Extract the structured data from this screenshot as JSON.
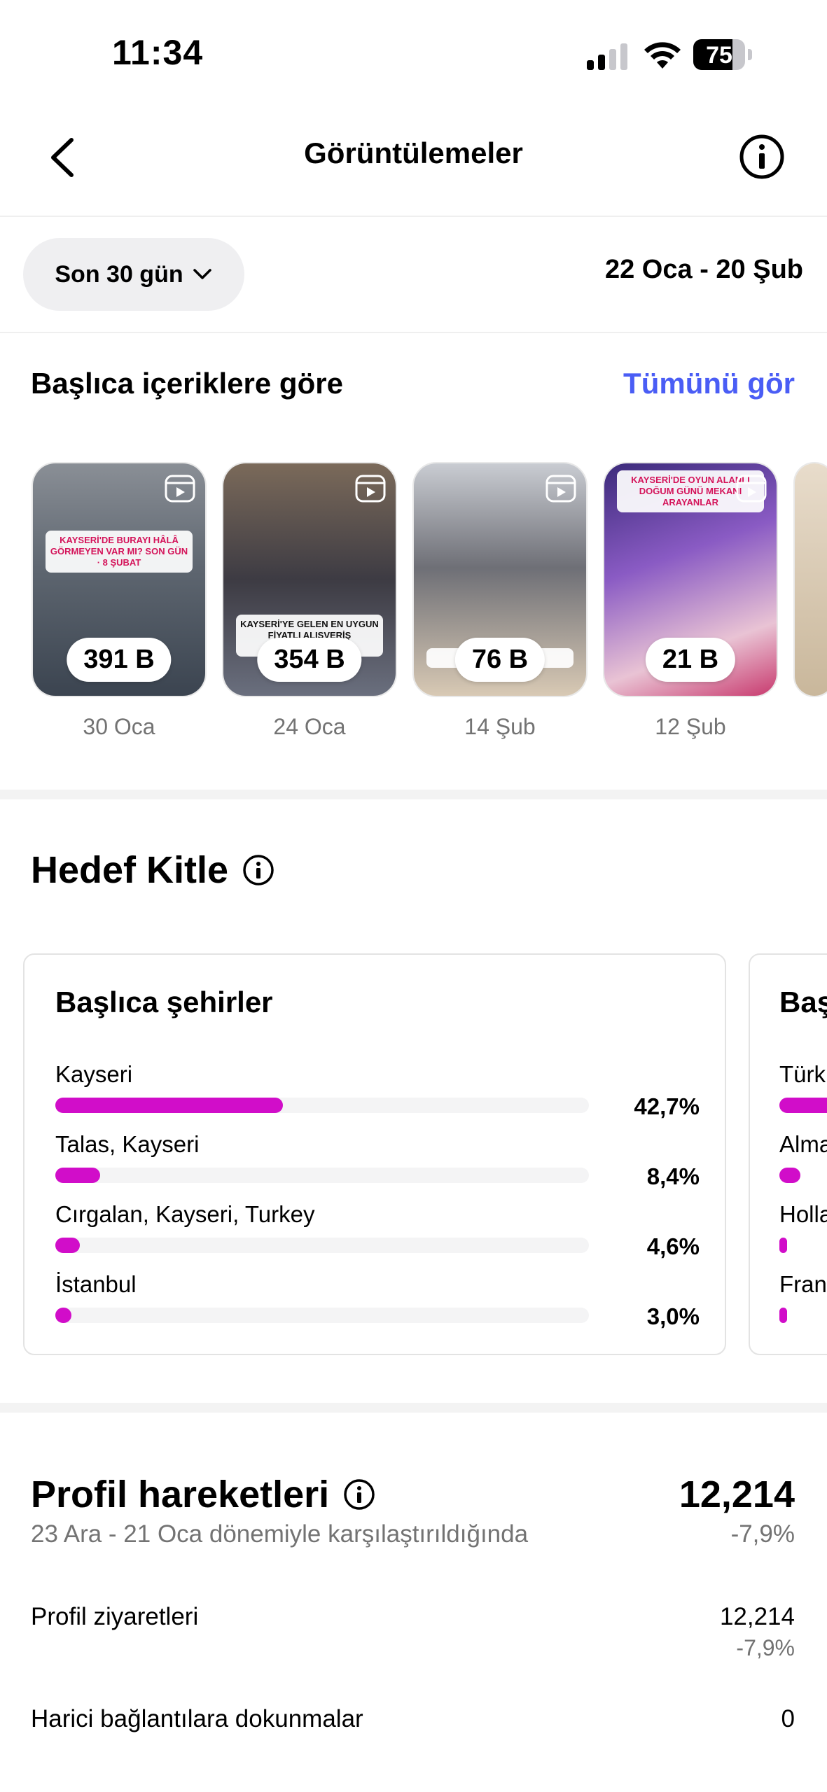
{
  "status_bar": {
    "time": "11:34",
    "battery": "75",
    "battery_level": 0.75
  },
  "header": {
    "title": "Görüntülemeler",
    "back_icon": "chevron-left-icon",
    "info_icon": "info-icon"
  },
  "filter": {
    "range_label": "Son 30 gün",
    "date_range": "22 Oca - 20 Şub"
  },
  "top_content": {
    "title": "Başlıca içeriklere göre",
    "see_all": "Tümünü gör",
    "items": [
      {
        "views": "391 B",
        "date": "30 Oca",
        "caption": "KAYSERİ'DE BURAYI HÂLÂ GÖRMEYEN VAR MI? SON GÜN · 8 ŞUBAT"
      },
      {
        "views": "354 B",
        "date": "24 Oca",
        "caption": "KAYSERİ'YE GELEN EN UYGUN FİYATLI ALIŞVERİŞ FESTİVALİNE"
      },
      {
        "views": "76 B",
        "date": "14 Şub",
        "caption": "HALI ... MÜ?"
      },
      {
        "views": "21 B",
        "date": "12 Şub",
        "caption": "KAYSERİ'DE OYUN ALANLI DOĞUM GÜNÜ MEKANI ARAYANLAR"
      }
    ]
  },
  "audience": {
    "title": "Hedef Kitle",
    "cities_card": {
      "title": "Başlıca şehirler",
      "rows": [
        {
          "name": "Kayseri",
          "percent": "42,7%",
          "value": 42.7
        },
        {
          "name": "Talas, Kayseri",
          "percent": "8,4%",
          "value": 8.4
        },
        {
          "name": "Cırgalan, Kayseri, Turkey",
          "percent": "4,6%",
          "value": 4.6
        },
        {
          "name": "İstanbul",
          "percent": "3,0%",
          "value": 3.0
        }
      ]
    },
    "countries_card": {
      "title": "Baş",
      "rows": [
        {
          "name": "Türk",
          "value": 90
        },
        {
          "name": "Alma",
          "value": 4
        },
        {
          "name": "Holla",
          "value": 1.5
        },
        {
          "name": "Fran",
          "value": 1.5
        }
      ]
    }
  },
  "profile_activity": {
    "title": "Profil hareketleri",
    "total": "12,214",
    "total_change": "-7,9%",
    "comparison": "23 Ara - 21 Oca dönemiyle karşılaştırıldığında",
    "rows": [
      {
        "label": "Profil ziyaretleri",
        "value": "12,214",
        "change": "-7,9%"
      },
      {
        "label": "Harici bağlantılara dokunmalar",
        "value": "0"
      }
    ]
  }
}
